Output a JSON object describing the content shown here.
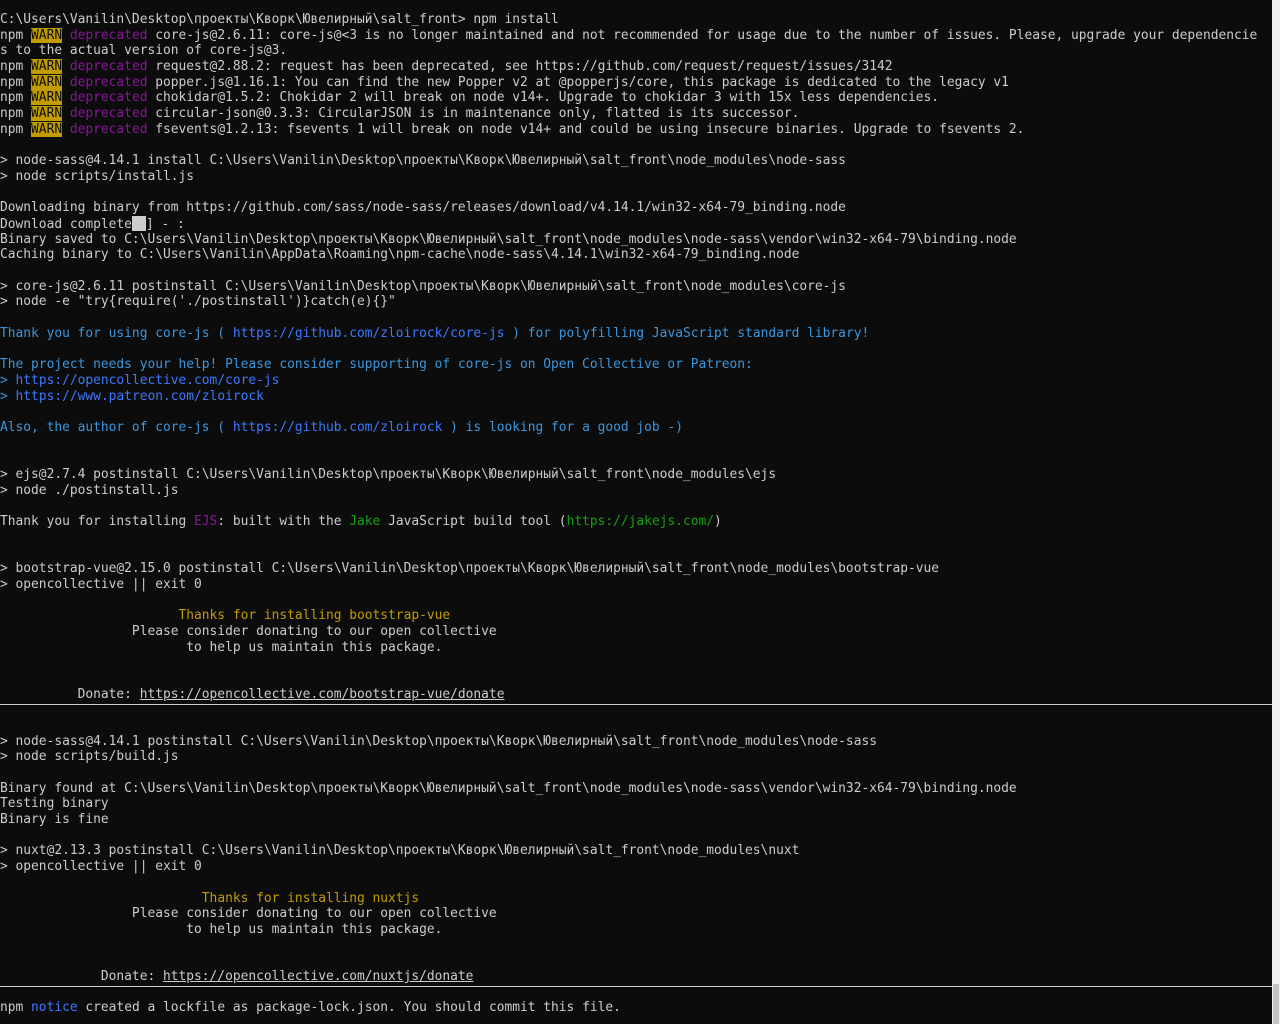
{
  "lines": [
    [
      {
        "t": "C:\\Users\\Vanilin\\Desktop\\проекты\\Кворк\\Ювелирный\\salt_front> npm install"
      }
    ],
    [
      {
        "t": "npm "
      },
      {
        "t": "WARN",
        "c": "c-warn"
      },
      {
        "t": " "
      },
      {
        "t": "deprecated",
        "c": "c-dep"
      },
      {
        "t": " core-js@2.6.11: core-js@<3 is no longer maintained and not recommended for usage due to the number of issues. Please, upgrade your dependencie"
      }
    ],
    [
      {
        "t": "s to the actual version of core-js@3."
      }
    ],
    [
      {
        "t": "npm "
      },
      {
        "t": "WARN",
        "c": "c-warn"
      },
      {
        "t": " "
      },
      {
        "t": "deprecated",
        "c": "c-dep"
      },
      {
        "t": " request@2.88.2: request has been deprecated, see https://github.com/request/request/issues/3142"
      }
    ],
    [
      {
        "t": "npm "
      },
      {
        "t": "WARN",
        "c": "c-warn"
      },
      {
        "t": " "
      },
      {
        "t": "deprecated",
        "c": "c-dep"
      },
      {
        "t": " popper.js@1.16.1: You can find the new Popper v2 at @popperjs/core, this package is dedicated to the legacy v1"
      }
    ],
    [
      {
        "t": "npm "
      },
      {
        "t": "WARN",
        "c": "c-warn"
      },
      {
        "t": " "
      },
      {
        "t": "deprecated",
        "c": "c-dep"
      },
      {
        "t": " chokidar@1.5.2: Chokidar 2 will break on node v14+. Upgrade to chokidar 3 with 15x less dependencies."
      }
    ],
    [
      {
        "t": "npm "
      },
      {
        "t": "WARN",
        "c": "c-warn"
      },
      {
        "t": " "
      },
      {
        "t": "deprecated",
        "c": "c-dep"
      },
      {
        "t": " circular-json@0.3.3: CircularJSON is in maintenance only, flatted is its successor."
      }
    ],
    [
      {
        "t": "npm "
      },
      {
        "t": "WARN",
        "c": "c-warn"
      },
      {
        "t": " "
      },
      {
        "t": "deprecated",
        "c": "c-dep"
      },
      {
        "t": " fsevents@1.2.13: fsevents 1 will break on node v14+ and could be using insecure binaries. Upgrade to fsevents 2."
      }
    ],
    [],
    [
      {
        "t": "> node-sass@4.14.1 install C:\\Users\\Vanilin\\Desktop\\проекты\\Кворк\\Ювелирный\\salt_front\\node_modules\\node-sass"
      }
    ],
    [
      {
        "t": "> node scripts/install.js"
      }
    ],
    [],
    [
      {
        "t": "Downloading binary from https://github.com/sass/node-sass/releases/download/v4.14.1/win32-x64-79_binding.node"
      }
    ],
    [
      {
        "t": "Download complete"
      },
      {
        "cursor": true
      },
      {
        "t": "] - :"
      }
    ],
    [
      {
        "t": "Binary saved to C:\\Users\\Vanilin\\Desktop\\проекты\\Кворк\\Ювелирный\\salt_front\\node_modules\\node-sass\\vendor\\win32-x64-79\\binding.node"
      }
    ],
    [
      {
        "t": "Caching binary to C:\\Users\\Vanilin\\AppData\\Roaming\\npm-cache\\node-sass\\4.14.1\\win32-x64-79_binding.node"
      }
    ],
    [],
    [
      {
        "t": "> core-js@2.6.11 postinstall C:\\Users\\Vanilin\\Desktop\\проекты\\Кворк\\Ювелирный\\salt_front\\node_modules\\core-js"
      }
    ],
    [
      {
        "t": "> node -e \"try{require('./postinstall')}catch(e){}\""
      }
    ],
    [],
    [
      {
        "t": "Thank you for using core-js ( ",
        "c": "c-cyan"
      },
      {
        "t": "https://github.com/zloirock/core-js",
        "c": "c-blue"
      },
      {
        "t": " ) for polyfilling JavaScript standard library!",
        "c": "c-cyan"
      }
    ],
    [],
    [
      {
        "t": "The project needs your help! Please consider supporting of core-js on Open Collective or Patreon:",
        "c": "c-cyan"
      }
    ],
    [
      {
        "t": "> ",
        "c": "c-cyan"
      },
      {
        "t": "https://opencollective.com/core-js",
        "c": "c-blue"
      }
    ],
    [
      {
        "t": "> ",
        "c": "c-cyan"
      },
      {
        "t": "https://www.patreon.com/zloirock",
        "c": "c-blue"
      }
    ],
    [],
    [
      {
        "t": "Also, the author of core-js ( ",
        "c": "c-cyan"
      },
      {
        "t": "https://github.com/zloirock",
        "c": "c-blue"
      },
      {
        "t": " ) is looking for a good job -)",
        "c": "c-cyan"
      }
    ],
    [],
    [],
    [
      {
        "t": "> ejs@2.7.4 postinstall C:\\Users\\Vanilin\\Desktop\\проекты\\Кворк\\Ювелирный\\salt_front\\node_modules\\ejs"
      }
    ],
    [
      {
        "t": "> node ./postinstall.js"
      }
    ],
    [],
    [
      {
        "t": "Thank you for installing "
      },
      {
        "t": "EJS",
        "c": "c-magenta"
      },
      {
        "t": ": built with the "
      },
      {
        "t": "Jake",
        "c": "c-green"
      },
      {
        "t": " JavaScript build tool ("
      },
      {
        "t": "https://jakejs.com/",
        "c": "c-green"
      },
      {
        "t": ")"
      }
    ],
    [],
    [],
    [
      {
        "t": "> bootstrap-vue@2.15.0 postinstall C:\\Users\\Vanilin\\Desktop\\проекты\\Кворк\\Ювелирный\\salt_front\\node_modules\\bootstrap-vue"
      }
    ],
    [
      {
        "t": "> opencollective || exit 0"
      }
    ],
    [],
    [
      {
        "t": "                       "
      },
      {
        "t": "Thanks for installing bootstrap-vue",
        "c": "c-yellow"
      }
    ],
    [
      {
        "t": "                 Please consider donating to our open collective"
      }
    ],
    [
      {
        "t": "                        to help us maintain this package."
      }
    ],
    [],
    [],
    [
      {
        "t": "          Donate: "
      },
      {
        "t": "https://opencollective.com/bootstrap-vue/donate",
        "c": "u"
      }
    ],
    [],
    [],
    [
      {
        "t": "> node-sass@4.14.1 postinstall C:\\Users\\Vanilin\\Desktop\\проекты\\Кворк\\Ювелирный\\salt_front\\node_modules\\node-sass"
      }
    ],
    [
      {
        "t": "> node scripts/build.js"
      }
    ],
    [],
    [
      {
        "t": "Binary found at C:\\Users\\Vanilin\\Desktop\\проекты\\Кворк\\Ювелирный\\salt_front\\node_modules\\node-sass\\vendor\\win32-x64-79\\binding.node"
      }
    ],
    [
      {
        "t": "Testing binary"
      }
    ],
    [
      {
        "t": "Binary is fine"
      }
    ],
    [],
    [
      {
        "t": "> nuxt@2.13.3 postinstall C:\\Users\\Vanilin\\Desktop\\проекты\\Кворк\\Ювелирный\\salt_front\\node_modules\\nuxt"
      }
    ],
    [
      {
        "t": "> opencollective || exit 0"
      }
    ],
    [],
    [
      {
        "t": "                          "
      },
      {
        "t": "Thanks for installing nuxtjs",
        "c": "c-yellow"
      }
    ],
    [
      {
        "t": "                 Please consider donating to our open collective"
      }
    ],
    [
      {
        "t": "                        to help us maintain this package."
      }
    ],
    [],
    [],
    [
      {
        "t": "             Donate: "
      },
      {
        "t": "https://opencollective.com/nuxtjs/donate",
        "c": "u"
      }
    ],
    [],
    [
      {
        "t": "npm "
      },
      {
        "t": "notice",
        "c": "c-blue"
      },
      {
        "t": " created a lockfile as package-lock.json. You should commit this file."
      }
    ]
  ]
}
